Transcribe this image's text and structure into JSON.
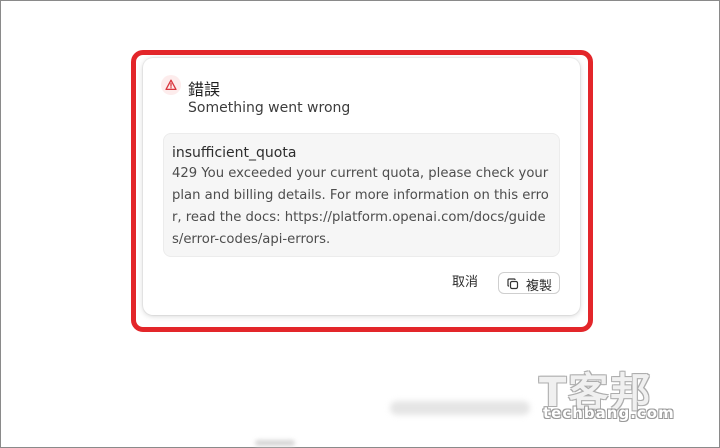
{
  "dialog": {
    "icon": "warning-triangle-icon",
    "title": "錯誤",
    "subtitle": "Something went wrong",
    "error": {
      "code": "insufficient_quota",
      "message": "429 You exceeded your current quota, please check your plan and billing details. For more information on this error, read the docs: https://platform.openai.com/docs/guides/error-codes/api-errors."
    },
    "cancel_label": "取消",
    "copy_icon": "copy-icon",
    "copy_label": "複製"
  },
  "watermark": {
    "brand_zh": "T客邦",
    "brand_en": "techbang.com"
  },
  "colors": {
    "highlight": "#e3262a",
    "warning": "#d9363e",
    "error_box_bg": "#f6f6f6"
  }
}
